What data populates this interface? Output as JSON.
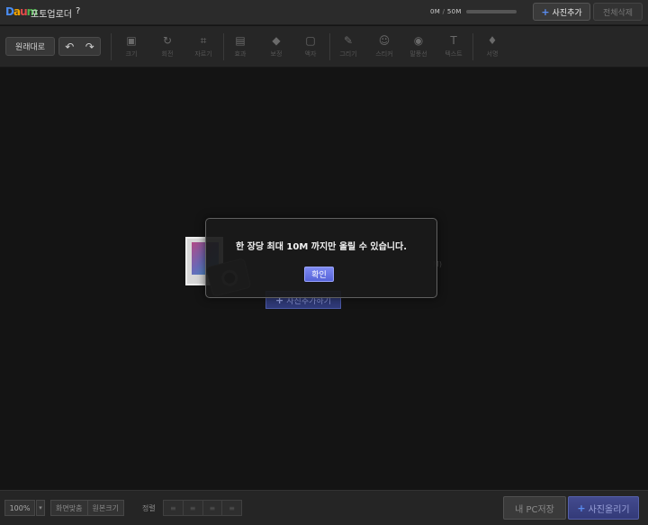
{
  "titlebar": {
    "logo": [
      "D",
      "a",
      "u",
      "m"
    ],
    "title": "포토업로더",
    "help": "?",
    "usage_used": "0M",
    "usage_sep": "/",
    "usage_total": "50M",
    "usage_fraction": 0,
    "add_photo": "사진추가",
    "delete_all": "전체삭제"
  },
  "toolbar": {
    "original": "원래대로",
    "undo_icon": "↶",
    "redo_icon": "↷",
    "tools": [
      {
        "icon": "▣",
        "label": "크기"
      },
      {
        "icon": "↻",
        "label": "회전"
      },
      {
        "icon": "⌗",
        "label": "자르기"
      },
      {
        "icon": "▤",
        "label": "효과"
      },
      {
        "icon": "◆",
        "label": "보정"
      },
      {
        "icon": "▢",
        "label": "액자"
      },
      {
        "icon": "✎",
        "label": "그리기"
      },
      {
        "icon": "☺",
        "label": "스티커"
      },
      {
        "icon": "◉",
        "label": "말풍선"
      },
      {
        "icon": "T",
        "label": "텍스트"
      },
      {
        "icon": "♦",
        "label": "서명"
      }
    ]
  },
  "empty_state": {
    "line1": "",
    "line2": "",
    "add_label": "사진추가하기",
    "size_hint": "M)"
  },
  "modal": {
    "message": "한 장당 최대 10M 까지만 올릴 수 있습니다.",
    "ok": "확인"
  },
  "bottombar": {
    "zoom": "100%",
    "zoom_arrow": "▾",
    "fit_screen": "화면맞춤",
    "original_size": "원본크기",
    "align_label": "정렬",
    "align_icons": [
      "≡",
      "≡",
      "≡",
      "≡"
    ],
    "save_pc": "내 PC저장",
    "upload": "사진올리기"
  },
  "colors": {
    "accent": "#5563d8",
    "background": "#141414",
    "toolbar": "#262626"
  }
}
